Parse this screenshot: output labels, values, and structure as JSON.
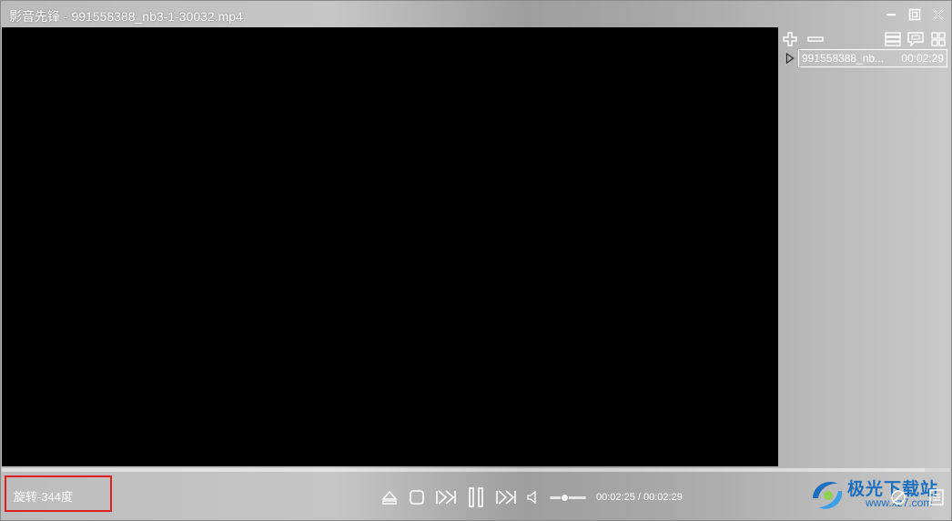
{
  "window": {
    "title": "影音先锋 - 991558388_nb3-1-30032.mp4"
  },
  "playlist": {
    "items": [
      {
        "name": "991558388_nb...",
        "duration": "00:02:29"
      }
    ]
  },
  "player": {
    "status_text": "旋转-344度",
    "current_time": "00:02:25",
    "total_time": "00:02:29",
    "time_display": "00:02:25 / 00:02:29",
    "progress_fraction": 0.973,
    "volume_fraction": 0.4
  },
  "watermark": {
    "text": "极光下载站",
    "url": "www.xz7.com"
  },
  "colors": {
    "video_bg": "#000000",
    "status_border": "#e02020",
    "watermark": "#1d6fbf"
  },
  "icons": {
    "minimize": "minimize-icon",
    "restore": "restore-icon",
    "close": "close-icon",
    "add": "plus-icon",
    "remove": "minus-icon",
    "list": "list-icon",
    "chat": "chat-icon",
    "grid": "grid-icon",
    "eject": "eject-icon",
    "stop": "stop-icon",
    "prev": "prev-icon",
    "pause": "pause-icon",
    "next": "next-icon",
    "volume": "speaker-icon",
    "no_subtitle": "slash-circle-icon",
    "menu": "menu-icon"
  }
}
